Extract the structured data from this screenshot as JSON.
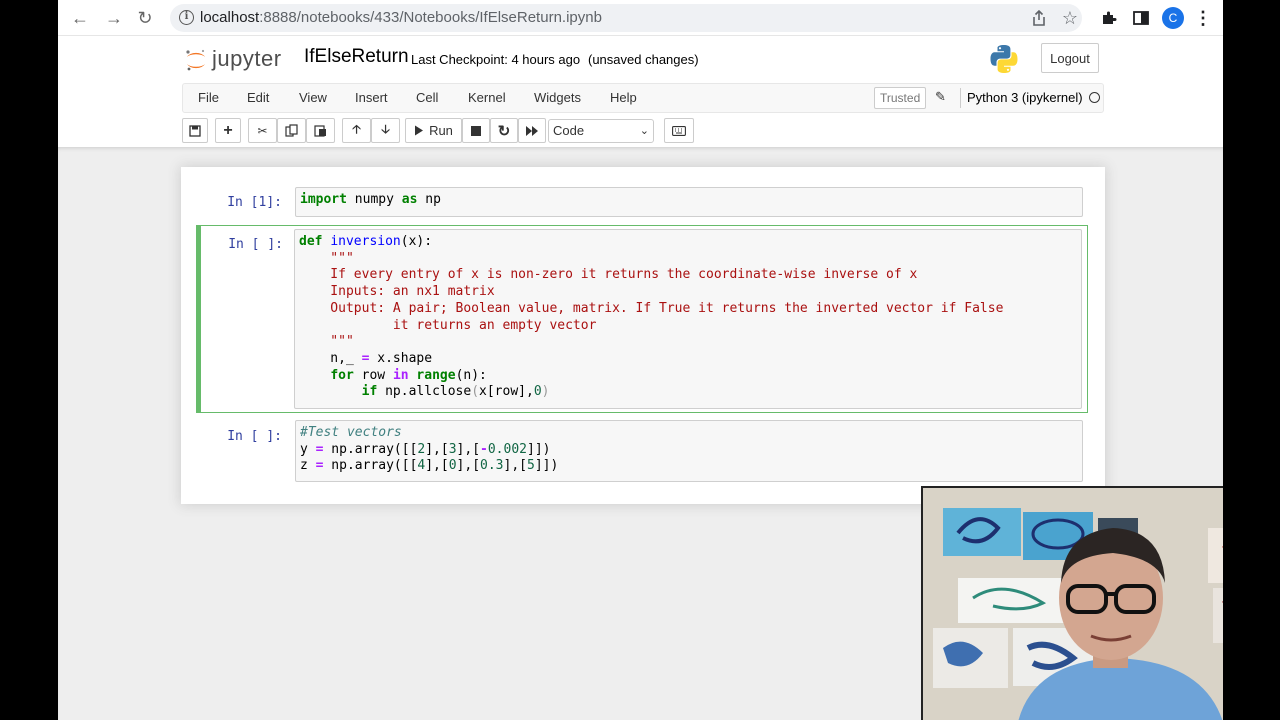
{
  "browser": {
    "url_host": "localhost",
    "url_path": ":8888/notebooks/433/Notebooks/IfElseReturn.ipynb",
    "avatar_letter": "C",
    "icons": [
      "back-icon",
      "forward-icon",
      "reload-icon",
      "site-info-icon",
      "share-icon",
      "bookmark-star-icon",
      "extensions-icon",
      "side-panel-icon",
      "profile-avatar",
      "menu-kebab-icon"
    ]
  },
  "header": {
    "logo_word": "jupyter",
    "notebook_name": "IfElseReturn",
    "checkpoint": "Last Checkpoint: 4 hours ago",
    "unsaved": "(unsaved changes)",
    "logout_label": "Logout"
  },
  "menubar": {
    "items": [
      "File",
      "Edit",
      "View",
      "Insert",
      "Cell",
      "Kernel",
      "Widgets",
      "Help"
    ],
    "trusted_label": "Trusted",
    "kernel_name": "Python 3 (ipykernel)"
  },
  "toolbar": {
    "run_label": "Run",
    "cell_type": "Code"
  },
  "cells": [
    {
      "prompt": "In [1]:",
      "lines": [
        [
          [
            "kw",
            "import"
          ],
          [
            "",
            " numpy "
          ],
          [
            "kw",
            "as"
          ],
          [
            "",
            " np"
          ]
        ]
      ]
    },
    {
      "prompt": "In [ ]:",
      "selected": true,
      "lines": [
        [
          [
            "kw",
            "def"
          ],
          [
            "",
            " "
          ],
          [
            "def",
            "inversion"
          ],
          [
            "",
            "(x):"
          ]
        ],
        [
          [
            "str",
            "    \"\"\""
          ]
        ],
        [
          [
            "str",
            "    If every entry of x is non-zero it returns the coordinate-wise inverse of x"
          ]
        ],
        [
          [
            "str",
            "    Inputs: an nx1 matrix"
          ]
        ],
        [
          [
            "str",
            "    Output: A pair; Boolean value, matrix. If True it returns the inverted vector if False"
          ]
        ],
        [
          [
            "str",
            "            it returns an empty vector"
          ]
        ],
        [
          [
            "str",
            "    \"\"\""
          ]
        ],
        [
          [
            "",
            "    n,_ "
          ],
          [
            "op",
            "="
          ],
          [
            "",
            " x.shape"
          ]
        ],
        [
          [
            "",
            "    "
          ],
          [
            "kw",
            "for"
          ],
          [
            "",
            " row "
          ],
          [
            "op",
            "in"
          ],
          [
            "",
            " "
          ],
          [
            "kw2",
            "range"
          ],
          [
            "",
            "(n):"
          ]
        ],
        [
          [
            "",
            "        "
          ],
          [
            "kw",
            "if"
          ],
          [
            "",
            " np.allclose"
          ],
          [
            "bracket",
            "("
          ],
          [
            "",
            "x[row],"
          ],
          [
            "num",
            "0"
          ],
          [
            "bracket",
            ")"
          ]
        ]
      ]
    },
    {
      "prompt": "In [ ]:",
      "lines": [
        [
          [
            "cmt",
            "#Test vectors"
          ]
        ],
        [
          [
            "",
            "y "
          ],
          [
            "op",
            "="
          ],
          [
            "",
            " np.array([["
          ],
          [
            "num",
            "2"
          ],
          [
            "",
            "],["
          ],
          [
            "num",
            "3"
          ],
          [
            "",
            "],["
          ],
          [
            "op2",
            "-"
          ],
          [
            "num",
            "0.002"
          ],
          [
            "",
            "]])"
          ]
        ],
        [
          [
            "",
            "z "
          ],
          [
            "op",
            "="
          ],
          [
            "",
            " np.array([["
          ],
          [
            "num",
            "4"
          ],
          [
            "",
            "],["
          ],
          [
            "num",
            "0"
          ],
          [
            "",
            "],["
          ],
          [
            "num",
            "0.3"
          ],
          [
            "",
            "],["
          ],
          [
            "num",
            "5"
          ],
          [
            "",
            "]])"
          ]
        ]
      ]
    }
  ],
  "webcam": {
    "description_icon": "webcam-overlay"
  }
}
